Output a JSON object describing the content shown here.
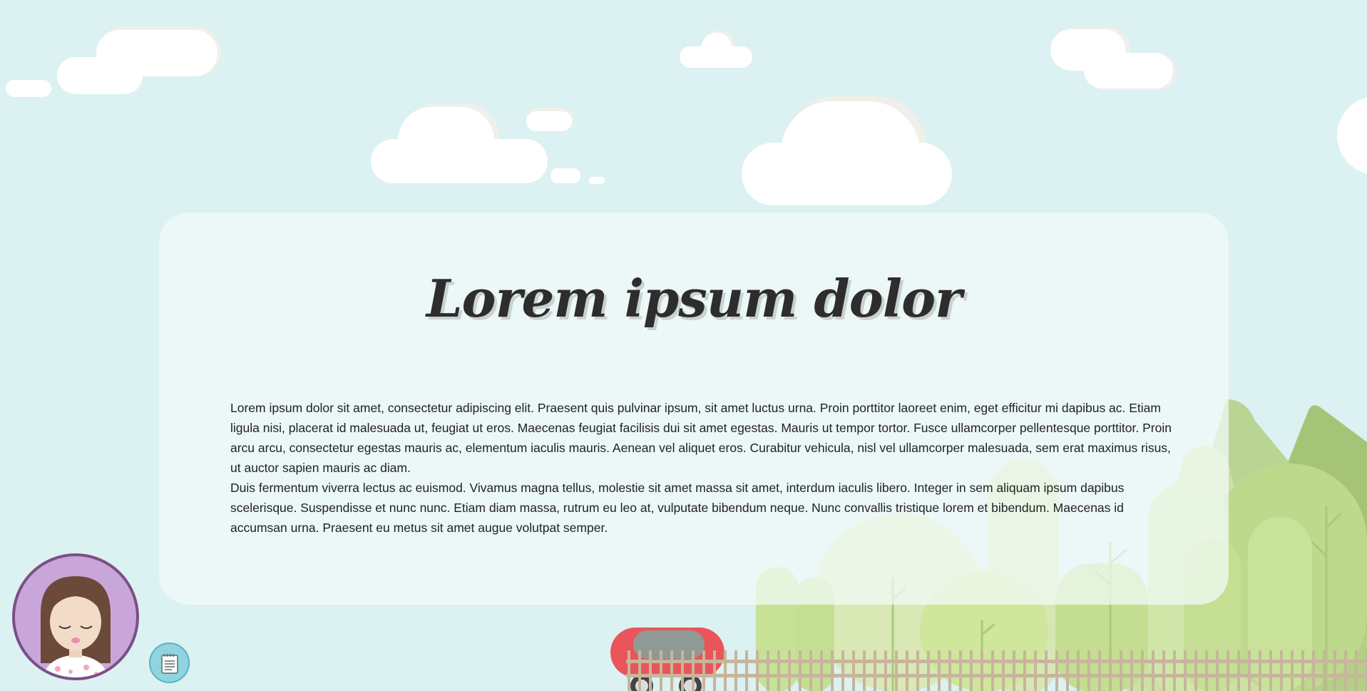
{
  "hero": {
    "title": "Lorem ipsum dolor",
    "paragraphs": [
      "Lorem ipsum dolor sit amet, consectetur adipiscing elit. Praesent quis pulvinar ipsum, sit amet luctus urna. Proin porttitor laoreet enim, eget efficitur mi dapibus ac. Etiam ligula nisi, placerat id malesuada ut, feugiat ut eros. Maecenas feugiat facilisis dui sit amet egestas. Mauris ut tempor tortor. Fusce ullamcorper pellentesque porttitor. Proin arcu arcu, consectetur egestas mauris ac, elementum iaculis mauris. Aenean vel aliquet eros. Curabitur vehicula, nisl vel ullamcorper malesuada, sem erat maximus risus, ut auctor sapien mauris ac diam.",
      "Duis fermentum viverra lectus ac euismod. Vivamus magna tellus, molestie sit amet massa sit amet, interdum iaculis libero. Integer in sem aliquam ipsum dapibus scelerisque. Suspendisse et nunc nunc. Etiam diam massa, rutrum eu leo at, vulputate bibendum neque. Nunc convallis tristique lorem et bibendum. Maecenas id accumsan urna. Praesent eu metus sit amet augue volutpat semper."
    ]
  },
  "icons": {
    "avatar": "girl-avatar",
    "notes": "notepad-icon"
  },
  "colors": {
    "sky": "#dcf1f1",
    "cloud": "#ffffff",
    "cloud_shadow": "#f1efe9",
    "card": "#f3fbf9",
    "title": "#2d2d2d",
    "avatar_bg": "#c9a6d9",
    "avatar_border": "#7a4f86",
    "notes_button": "#8fd4e0",
    "car": "#e9555a",
    "fence": "#c7b59c"
  }
}
